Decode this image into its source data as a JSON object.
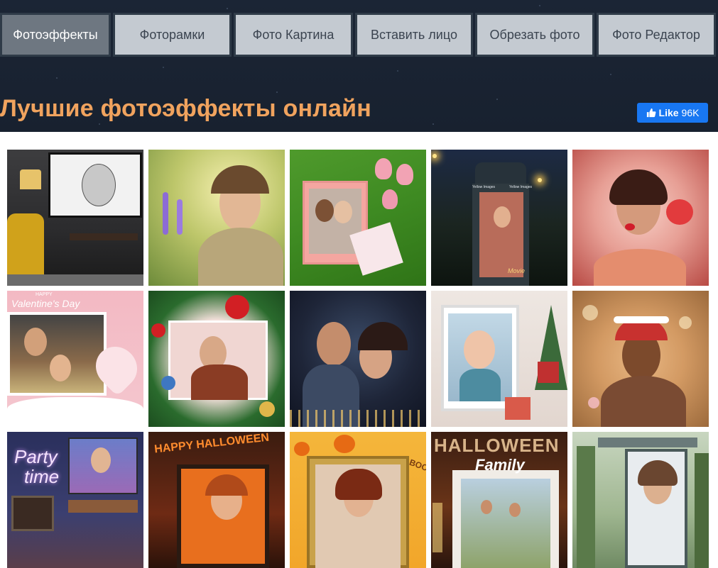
{
  "nav": {
    "tabs": [
      {
        "label": "Фотоэффекты",
        "active": true
      },
      {
        "label": "Фоторамки",
        "active": false
      },
      {
        "label": "Фото Картина",
        "active": false
      },
      {
        "label": "Вставить лицо",
        "active": false
      },
      {
        "label": "Обрезать фото",
        "active": false
      },
      {
        "label": "Фото Редактор",
        "active": false
      }
    ]
  },
  "page": {
    "title": "Лучшие фотоэффекты онлайн"
  },
  "like": {
    "label": "Like",
    "count": "96K",
    "color": "#1877f2"
  },
  "tiles": [
    {
      "name": "pencil-sketch-room-effect"
    },
    {
      "name": "spring-flowers-portrait-effect"
    },
    {
      "name": "grass-frame-tulips-effect"
    },
    {
      "name": "advertising-column-night-effect",
      "texts": [
        "Movie",
        "Yellow Images",
        "Yellow Images"
      ]
    },
    {
      "name": "red-rose-kiss-effect"
    },
    {
      "name": "valentines-day-frame-effect",
      "texts": [
        "HAPPY",
        "Valentine's Day"
      ]
    },
    {
      "name": "christmas-wreath-frame-effect"
    },
    {
      "name": "couple-bokeh-lights-effect"
    },
    {
      "name": "christmas-white-frame-effect"
    },
    {
      "name": "golden-bokeh-portrait-effect"
    },
    {
      "name": "party-time-neon-effect",
      "texts": [
        "Party",
        "time"
      ]
    },
    {
      "name": "happy-halloween-frame-effect",
      "texts": [
        "HAPPY HALLOWEEN"
      ]
    },
    {
      "name": "pumpkin-golden-frame-effect",
      "texts": [
        "BOO"
      ]
    },
    {
      "name": "halloween-family-frame-effect",
      "texts": [
        "HALLOWEEN",
        "Family"
      ]
    },
    {
      "name": "bus-stop-billboard-effect"
    }
  ]
}
